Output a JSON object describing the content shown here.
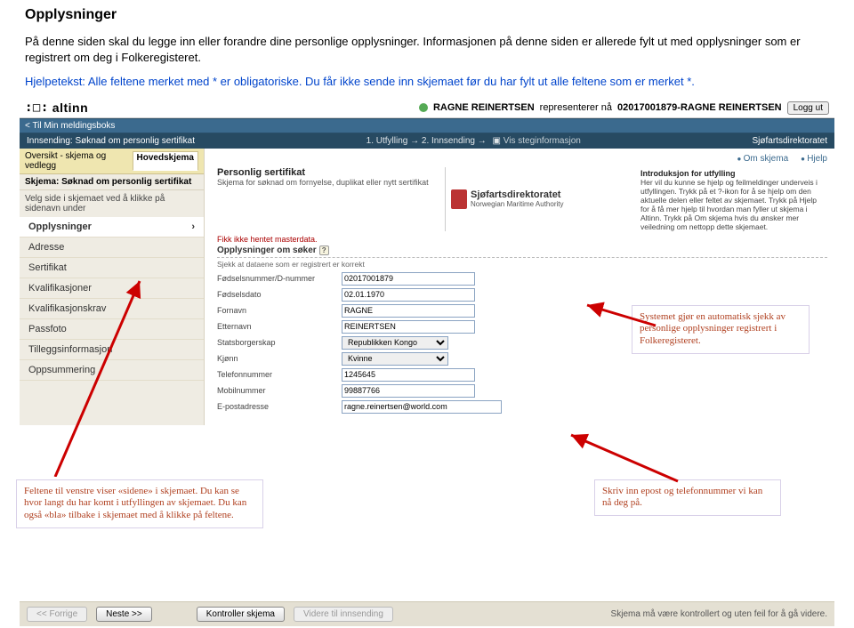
{
  "doc": {
    "title": "Opplysninger",
    "para1": "På denne siden skal du legge inn eller forandre dine personlige opplysninger. Informasjonen på denne siden er allerede fylt ut med opplysninger som er registrert om deg i Folkeregisteret.",
    "para2": "Hjelpetekst: Alle feltene merket med * er obligatoriske. Du får ikke sende inn skjemaet før du har fylt ut alle feltene som er merket *."
  },
  "altinn": {
    "logo": "altinn",
    "rep_prefix": "RAGNE REINERTSEN",
    "rep_text": "representerer nå",
    "rep_id": "02017001879-RAGNE REINERTSEN",
    "logout": "Logg ut",
    "back": "< Til Min meldingsboks",
    "sending": "Innsending: Søknad om personlig sertifikat",
    "steps": "1. Utfylling → 2. Innsending →",
    "stepinfo": "Vis steginformasjon",
    "dept": "Sjøfartsdirektoratet"
  },
  "sidebar": {
    "overview": "Oversikt - skjema og vedlegg",
    "hoved": "Hovedskjema",
    "scheme": "Skjema: Søknad om personlig sertifikat",
    "choose": "Velg side i skjemaet ved å klikke på sidenavn under",
    "items": [
      "Opplysninger",
      "Adresse",
      "Sertifikat",
      "Kvalifikasjoner",
      "Kvalifikasjonskrav",
      "Passfoto",
      "Tilleggsinformasjon",
      "Oppsummering"
    ]
  },
  "right": {
    "om": "Om skjema",
    "hjelp": "Hjelp",
    "h": "Personlig sertifikat",
    "sub": "Skjema for søknad om fornyelse, duplikat eller nytt sertifikat",
    "sjodir1": "Sjøfartsdirektoratet",
    "sjodir2": "Norwegian Maritime Authority",
    "intro_h": "Introduksjon for utfylling",
    "intro_t": "Her vil du kunne se hjelp og feilmeldinger underveis i utfyllingen. Trykk på et ?-ikon for å se hjelp om den aktuelle delen eller feltet av skjemaet. Trykk på Hjelp for å få mer hjelp til hvordan man fyller ut skjema i Altinn. Trykk på Om skjema hvis du ønsker mer veiledning om nettopp dette skjemaet.",
    "red": "Fikk ikke hentet masterdata.",
    "grp": "Opplysninger om søker",
    "check": "Sjekk at dataene som er registrert er korrekt"
  },
  "fields": {
    "fnr_l": "Fødselsnummer/D-nummer",
    "fnr_v": "02017001879",
    "fdato_l": "Fødselsdato",
    "fdato_v": "02.01.1970",
    "fn_l": "Fornavn",
    "fn_v": "RAGNE",
    "en_l": "Etternavn",
    "en_v": "REINERTSEN",
    "stat_l": "Statsborgerskap",
    "stat_v": "Republikken Kongo",
    "kj_l": "Kjønn",
    "kj_v": "Kvinne",
    "tlf_l": "Telefonnummer",
    "tlf_v": "1245645",
    "mob_l": "Mobilnummer",
    "mob_v": "99887766",
    "ep_l": "E-postadresse",
    "ep_v": "ragne.reinertsen@world.com"
  },
  "annot": {
    "right": "Systemet gjør en automatisk sjekk av personlige opplysninger registrert i Folkeregisteret.",
    "left": "Feltene til venstre viser «sidene» i skjemaet. Du kan se hvor langt du har komt i utfyllingen av skjemaet. Du kan også «bla» tilbake i skjemaet med å klikke på feltene.",
    "br": "Skriv inn epost og telefonnummer vi kan nå deg på."
  },
  "footer": {
    "prev": "<< Forrige",
    "next": "Neste >>",
    "ctrl": "Kontroller skjema",
    "send": "Videre til innsending",
    "note": "Skjema må være kontrollert og uten feil for å gå videre."
  }
}
